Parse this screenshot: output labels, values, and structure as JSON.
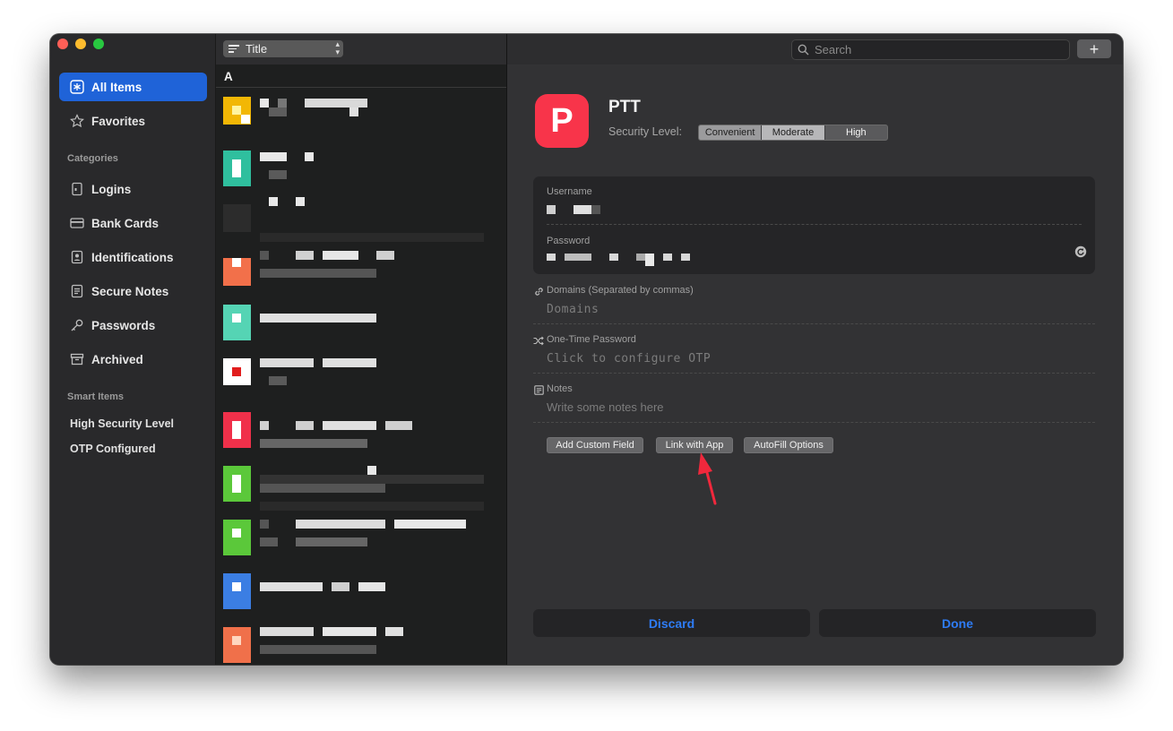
{
  "sidebar": {
    "items": [
      {
        "label": "All Items",
        "icon": "asterisk-icon"
      },
      {
        "label": "Favorites",
        "icon": "star-icon"
      }
    ],
    "categories_heading": "Categories",
    "categories": [
      {
        "label": "Logins",
        "icon": "login-icon"
      },
      {
        "label": "Bank Cards",
        "icon": "card-icon"
      },
      {
        "label": "Identifications",
        "icon": "id-icon"
      },
      {
        "label": "Secure Notes",
        "icon": "note-icon"
      },
      {
        "label": "Passwords",
        "icon": "key-icon"
      },
      {
        "label": "Archived",
        "icon": "archive-icon"
      }
    ],
    "smart_heading": "Smart Items",
    "smart_items": [
      "High Security Level",
      "OTP Configured"
    ]
  },
  "list": {
    "sort_label": "Title",
    "section_letter": "A"
  },
  "toolbar": {
    "search_placeholder": "Search",
    "add_label": "+"
  },
  "detail": {
    "icon_letter": "P",
    "title": "PTT",
    "security_label": "Security Level:",
    "security_levels": [
      "Convenient",
      "Moderate",
      "High"
    ],
    "username_label": "Username",
    "password_label": "Password",
    "domains_label": "Domains (Separated by commas)",
    "domains_placeholder": "Domains",
    "otp_label": "One-Time Password",
    "otp_placeholder": "Click to configure OTP",
    "notes_label": "Notes",
    "notes_placeholder": "Write some notes here",
    "buttons": {
      "add_custom_field": "Add Custom Field",
      "link_with_app": "Link with App",
      "autofill_options": "AutoFill Options",
      "discard": "Discard",
      "done": "Done"
    }
  },
  "colors": {
    "accent": "#1f63d8",
    "button_text": "#2e7cf6",
    "app_icon": "#f8344a",
    "annotation_arrow": "#f0283c"
  }
}
